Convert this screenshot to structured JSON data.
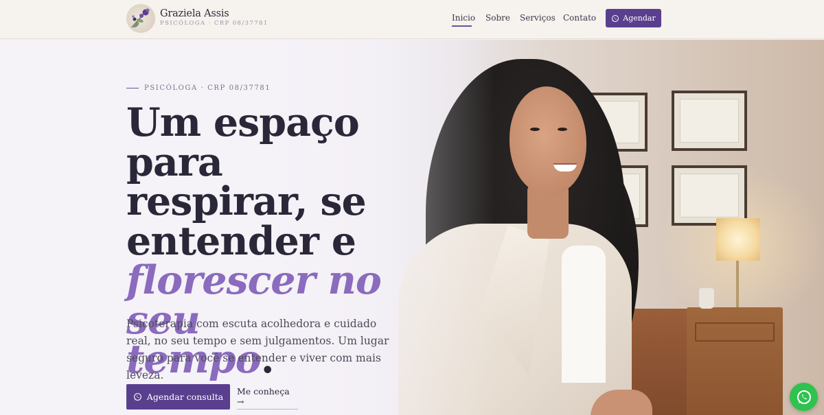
{
  "header": {
    "brand_name": "Graziela Assis",
    "brand_sub": "PSICÓLOGA · CRP 08/37781",
    "nav": [
      {
        "label": "Inicio",
        "active": true
      },
      {
        "label": "Sobre"
      },
      {
        "label": "Serviços"
      },
      {
        "label": "Contato"
      }
    ],
    "cta_label": "Agendar"
  },
  "hero": {
    "eyebrow": "PSICÓLOGA · CRP 08/37781",
    "headline_line1": "Um espaço para",
    "headline_line2": "respirar, se",
    "headline_line3": "entender e",
    "headline_accent1": "florescer no seu",
    "headline_accent2": "tempo",
    "headline_dot": ".",
    "lead": "Psicoterapia com escuta acolhedora e cuidado real, no seu tempo e sem julgamentos. Um lugar seguro para você se entender e viver com mais leveza.",
    "primary_cta": "Agendar consulta",
    "secondary_cta": "Me conheça →"
  },
  "colors": {
    "accent": "#5a3f8e",
    "accent_light": "#8a6bbd",
    "whatsapp": "#2fc24f"
  },
  "icons": {
    "whatsapp": "whatsapp-icon",
    "logo": "flower-logo-icon"
  }
}
